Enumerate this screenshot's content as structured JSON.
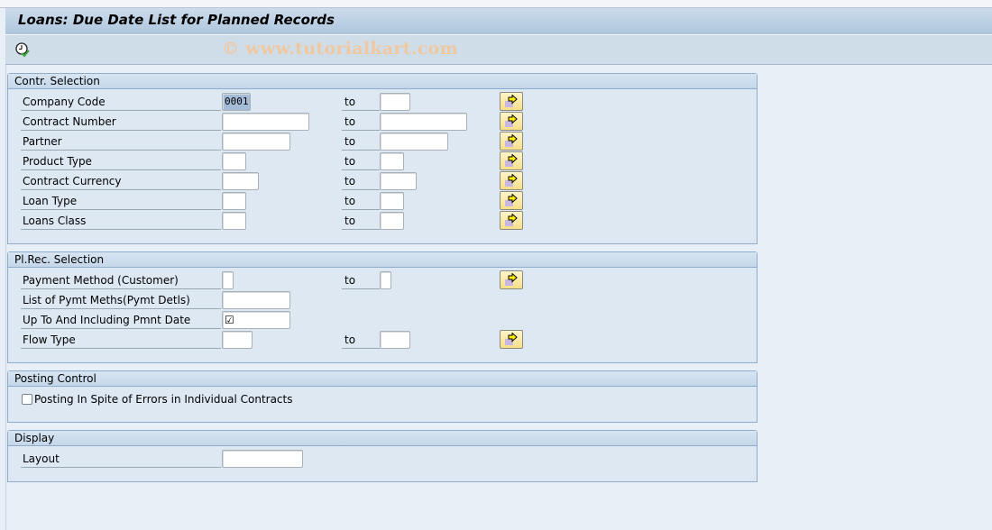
{
  "window": {
    "title": "Loans: Due Date List for Planned Records",
    "watermark": "© www.tutorialkart.com"
  },
  "toolbar": {
    "execute_icon": "execute-clock-check-icon"
  },
  "groups": {
    "contr": {
      "title": "Contr. Selection",
      "to_label": "to",
      "rows": [
        {
          "label": "Company Code",
          "low": "0001",
          "high": ""
        },
        {
          "label": "Contract Number",
          "low": "",
          "high": ""
        },
        {
          "label": "Partner",
          "low": "",
          "high": ""
        },
        {
          "label": "Product Type",
          "low": "",
          "high": ""
        },
        {
          "label": "Contract Currency",
          "low": "",
          "high": ""
        },
        {
          "label": "Loan Type",
          "low": "",
          "high": ""
        },
        {
          "label": "Loans Class",
          "low": "",
          "high": ""
        }
      ]
    },
    "plrec": {
      "title": "Pl.Rec. Selection",
      "to_label": "to",
      "rows": [
        {
          "label": "Payment Method (Customer)",
          "low": "",
          "high": ""
        },
        {
          "label": "List of Pymt Meths(Pymt Detls)",
          "low": ""
        },
        {
          "label": "Up To And Including Pmnt Date",
          "value": "☑",
          "checked": true
        },
        {
          "label": "Flow Type",
          "low": "",
          "high": ""
        }
      ]
    },
    "posting": {
      "title": "Posting Control",
      "checkbox_label": "Posting In Spite of Errors in Individual Contracts",
      "checked": false
    },
    "display": {
      "title": "Display",
      "layout_label": "Layout",
      "layout_value": ""
    }
  },
  "icons": {
    "multiple_selection": "multiple-selection-arrow-icon"
  }
}
